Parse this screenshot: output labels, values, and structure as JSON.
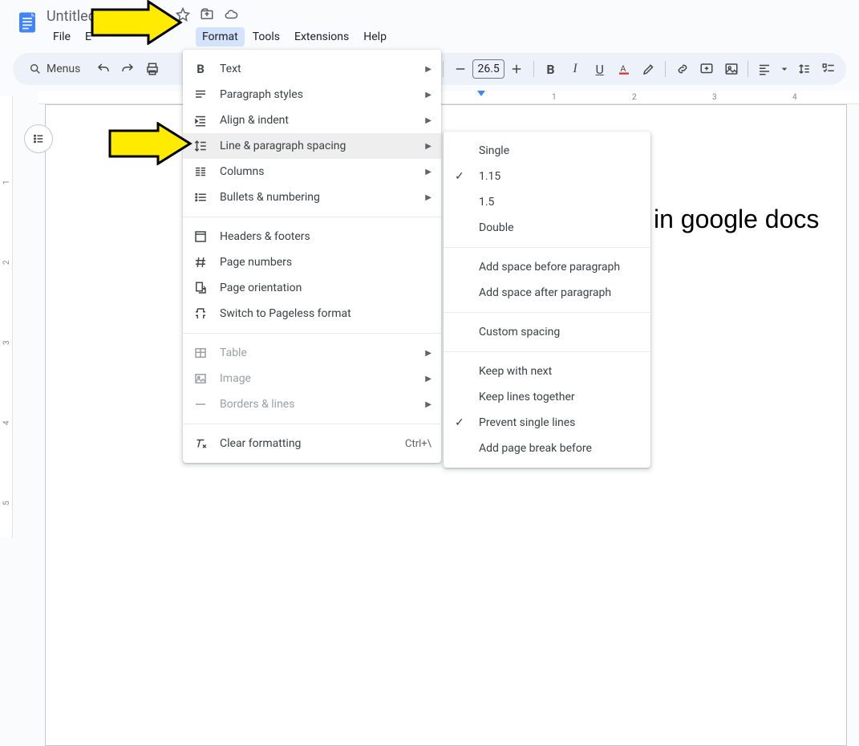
{
  "doc_title": "Untitled document",
  "menubar": {
    "file": "File",
    "edit": "E",
    "format": "Format",
    "tools": "Tools",
    "extensions": "Extensions",
    "help": "Help"
  },
  "toolbar": {
    "menus": "Menus",
    "font_size": "26.5"
  },
  "ruler_h": {
    "n1": "1",
    "n2": "2",
    "n3": "3",
    "n4": "4"
  },
  "ruler_v": {
    "n1": "1",
    "n2": "2",
    "n3": "3",
    "n4": "4",
    "n5": "5"
  },
  "format_menu": {
    "text": "Text",
    "paragraph_styles": "Paragraph styles",
    "align_indent": "Align & indent",
    "line_paragraph_spacing": "Line & paragraph spacing",
    "columns": "Columns",
    "bullets_numbering": "Bullets & numbering",
    "headers_footers": "Headers & footers",
    "page_numbers": "Page numbers",
    "page_orientation": "Page orientation",
    "switch_pageless": "Switch to Pageless format",
    "table": "Table",
    "image": "Image",
    "borders_lines": "Borders & lines",
    "clear_formatting": "Clear formatting",
    "clear_formatting_shortcut": "Ctrl+\\"
  },
  "spacing_submenu": {
    "single": "Single",
    "v115": "1.15",
    "v15": "1.5",
    "double": "Double",
    "add_before": "Add space before paragraph",
    "add_after": "Add space after paragraph",
    "custom": "Custom spacing",
    "keep_next": "Keep with next",
    "keep_together": "Keep lines together",
    "prevent_single": "Prevent single lines",
    "page_break_before": "Add page break before"
  },
  "doc_content": "in google docs"
}
